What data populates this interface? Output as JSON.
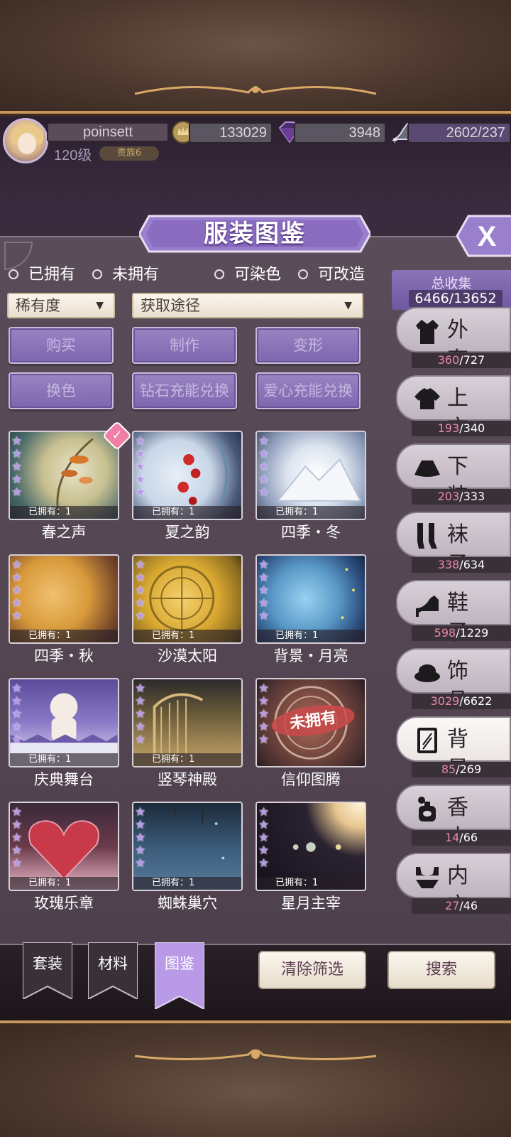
{
  "status": {
    "username": "poinsett",
    "level": "120级",
    "vip": "贵族6",
    "gold": "133029",
    "diamond": "3948",
    "stamina": "2602/237"
  },
  "title": "服装图鉴",
  "close_label": "X",
  "filters": {
    "radios": [
      "已拥有",
      "未拥有",
      "可染色",
      "可改造"
    ],
    "rarity_select": "稀有度",
    "source_select": "获取途径",
    "buttons": [
      "购买",
      "制作",
      "变形",
      "换色",
      "钻石充能兑换",
      "爱心充能兑换"
    ]
  },
  "collection": {
    "label": "总收集",
    "value": "6466/13652"
  },
  "categories": [
    {
      "label": "外套",
      "have": "360",
      "total": "/727",
      "icon": "coat-icon"
    },
    {
      "label": "上衣",
      "have": "193",
      "total": "/340",
      "icon": "shirt-icon"
    },
    {
      "label": "下装",
      "have": "203",
      "total": "/333",
      "icon": "skirt-icon"
    },
    {
      "label": "袜子",
      "have": "338",
      "total": "/634",
      "icon": "socks-icon"
    },
    {
      "label": "鞋子",
      "have": "598",
      "total": "/1229",
      "icon": "heel-shoe-icon"
    },
    {
      "label": "饰品",
      "have": "3029",
      "total": "/6622",
      "icon": "hat-icon"
    },
    {
      "label": "背景",
      "have": "85",
      "total": "/269",
      "icon": "background-frame-icon"
    },
    {
      "label": "香水",
      "have": "14",
      "total": "/66",
      "icon": "perfume-icon"
    },
    {
      "label": "内衣",
      "have": "27",
      "total": "/46",
      "icon": "lingerie-icon"
    }
  ],
  "items": [
    {
      "name": "春之声",
      "owned": "已拥有：1",
      "stars": 5
    },
    {
      "name": "夏之韵",
      "owned": "已拥有：1",
      "stars": 5
    },
    {
      "name": "四季・冬",
      "owned": "已拥有：1",
      "stars": 5
    },
    {
      "name": "四季・秋",
      "owned": "已拥有：1",
      "stars": 5
    },
    {
      "name": "沙漠太阳",
      "owned": "已拥有：1",
      "stars": 5
    },
    {
      "name": "背景・月亮",
      "owned": "已拥有：1",
      "stars": 5
    },
    {
      "name": "庆典舞台",
      "owned": "已拥有：1",
      "stars": 5
    },
    {
      "name": "竖琴神殿",
      "owned": "已拥有：1",
      "stars": 5
    },
    {
      "name": "信仰图腾",
      "owned": "",
      "stars": 5,
      "stamp": "未拥有"
    },
    {
      "name": "玫瑰乐章",
      "owned": "已拥有：1",
      "stars": 5
    },
    {
      "name": "蜘蛛巢穴",
      "owned": "已拥有：1",
      "stars": 5
    },
    {
      "name": "星月主宰",
      "owned": "已拥有：1",
      "stars": 5
    }
  ],
  "tabs": [
    "套装",
    "材料",
    "图鉴"
  ],
  "actions": {
    "clear": "清除筛选",
    "search": "搜索"
  },
  "colors": {
    "accent_purple": "#8c74b8",
    "count_pink": "#e88aa6",
    "panel": "#5a4c58"
  }
}
